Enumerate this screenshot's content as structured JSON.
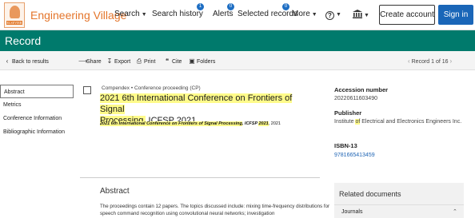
{
  "header": {
    "logo_text": "ELSEVIER",
    "brand": "Engineering Village",
    "nav": [
      {
        "label": "Search",
        "caret": true
      },
      {
        "label": "Search history",
        "badge": "1"
      },
      {
        "label": "Alerts",
        "badge": "0"
      },
      {
        "label": "Selected records",
        "badge": "0"
      },
      {
        "label": "More",
        "caret": true
      }
    ],
    "help_icon": "question-icon",
    "institution_icon": "institution-icon",
    "create_account": "Create account",
    "sign_in": "Sign in"
  },
  "band": {
    "title": "Record"
  },
  "toolbar": {
    "back": "Back to results",
    "share": "Share",
    "export": "Export",
    "print": "Print",
    "cite": "Cite",
    "folders": "Folders",
    "pager": "Record 1 of 16"
  },
  "leftnav": {
    "items": [
      {
        "label": "Abstract",
        "active": true
      },
      {
        "label": "Metrics"
      },
      {
        "label": "Conference Information"
      },
      {
        "label": "Bibliographic Information"
      }
    ]
  },
  "record": {
    "source": "Compendex",
    "doc_type": "Conference proceeding (CP)",
    "title_line1": "2021 6th International Conference on Frontiers of Signal",
    "title_line2": "Processing,",
    "title_tail": " ICFSP 2021",
    "citation_hl": "2021 6th International Conference on Frontiers of Signal Processing",
    "citation_mid": ", ICFSP ",
    "citation_year_hl": "2021",
    "citation_end": ", 2021"
  },
  "details": {
    "accession_label": "Accession number",
    "accession_value": "20220611603490",
    "publisher_label": "Publisher",
    "publisher_value_pre": "Institute ",
    "publisher_value_hl": "of",
    "publisher_value_post": " Electrical and Electronics Engineers Inc.",
    "isbn_label": "ISBN-13",
    "isbn_value": "9781665413459"
  },
  "abstract": {
    "heading": "Abstract",
    "text": "The proceedings contain 12 papers. The topics discussed include: mixing time-frequency distributions for speech command recognition using convolutional neural networks; investigation"
  },
  "related": {
    "heading": "Related documents",
    "journals": "Journals"
  },
  "colors": {
    "brand": "#e4752b",
    "band": "#007a6c",
    "primary": "#1a66b8",
    "highlight": "#fffb8a"
  }
}
